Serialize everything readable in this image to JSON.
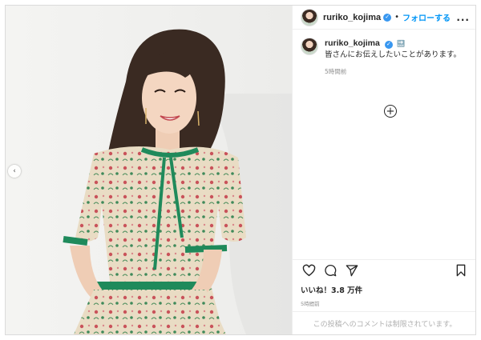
{
  "post": {
    "username": "ruriko_kojima",
    "follow_label": "フォローする",
    "separator": "•",
    "more_label": "...",
    "caption_emoji": "🔜",
    "caption_text": "皆さんにお伝えしたいことがあります。",
    "caption_time": "5時間前",
    "likes": "いいね！3.8 万件",
    "post_time": "5時間前",
    "comments_disabled": "この投稿へのコメントは制限されています。"
  },
  "colors": {
    "accent": "#0095f6",
    "verified": "#3897f0",
    "dress_green": "#1f8a5b"
  },
  "icons": {
    "verified": "verified-badge-icon",
    "load_more": "plus-circle-icon",
    "like": "heart-icon",
    "comment": "comment-bubble-icon",
    "share": "paper-plane-icon",
    "save": "bookmark-icon",
    "prev": "chevron-left-icon"
  }
}
